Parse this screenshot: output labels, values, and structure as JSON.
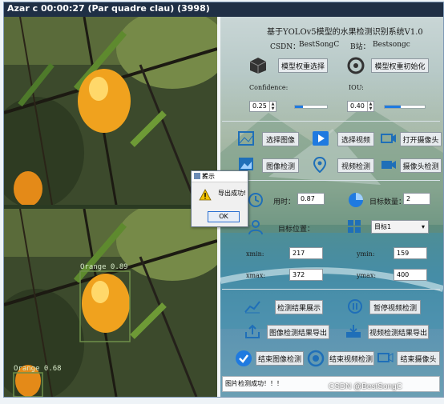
{
  "window": {
    "title": "Azar c 00:00:27 (Par quadre clau) (3998)"
  },
  "panel": {
    "system_title": "基于YOLOv5模型的水果检测识别系统V1.0",
    "csdn": "CSDN：",
    "csdn_value": "BestSongC",
    "bili": "B站：",
    "bili_value": "Bestsongc",
    "btn_select_weights": "模型权重选择",
    "btn_init_weights": "模型权重初始化",
    "confidence_label": "Confidence:",
    "confidence_value": "0.25",
    "confidence_level": 0.25,
    "iou_label": "IOU:",
    "iou_value": "0.40",
    "iou_level": 0.4,
    "btn_select_image": "选择图像",
    "btn_select_video": "选择视频",
    "btn_open_camera": "打开摄像头",
    "btn_image_detect": "图像检测",
    "btn_video_detect": "视频检测",
    "btn_camera_detect": "摄像头检测",
    "time_label": "用时：",
    "time_value": "0.87",
    "count_label": "目标数量：",
    "count_value": "2",
    "target_pos_label": "目标位置：",
    "target_select": "目标1",
    "xmin_label": "xmin:",
    "xmin_value": "217",
    "ymin_label": "ymin:",
    "ymin_value": "159",
    "xmax_label": "xmax:",
    "xmax_value": "372",
    "ymax_label": "ymax:",
    "ymax_value": "400",
    "btn_show_results": "检测结果展示",
    "btn_pause_video": "暂停视频检测",
    "btn_export_image": "图像检测结果导出",
    "btn_export_video": "视频检测结果导出",
    "btn_end_image": "结束图像检测",
    "btn_end_video": "结束视频检测",
    "btn_close_camera": "结束摄像头",
    "status_text": "图片检测成功！！！"
  },
  "detections": [
    {
      "label": "Orange 0.89"
    },
    {
      "label": "Orange 0.68"
    }
  ],
  "dialog": {
    "title": "提示",
    "message": "导出成功!",
    "ok": "OK"
  },
  "watermark": "CSDN @BestSongC",
  "colors": {
    "accent": "#1f7ae0",
    "titlebar": "#1f2f45",
    "detect_box": "#6f8f4a"
  }
}
